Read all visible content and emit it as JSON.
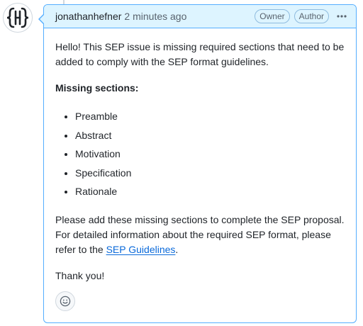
{
  "comment": {
    "author": "jonathanhefner",
    "timestamp": "2 minutes ago",
    "badges": [
      "Owner",
      "Author"
    ],
    "icons": {
      "avatar": "hefner-logo-avatar",
      "menu": "kebab-horizontal-icon",
      "reaction": "smiley-icon"
    },
    "colors": {
      "header_bg": "#ddf4ff",
      "border": "#54aeff",
      "link": "#0969da"
    },
    "body": {
      "intro": "Hello! This SEP issue is missing required sections that need to be added to comply with the SEP format guidelines.",
      "missing_heading": "Missing sections:",
      "missing_sections": [
        "Preamble",
        "Abstract",
        "Motivation",
        "Specification",
        "Rationale"
      ],
      "closing_before_link": "Please add these missing sections to complete the SEP proposal. For detailed information about the required SEP format, please refer to the ",
      "link_text": "SEP Guidelines",
      "closing_after_link": ".",
      "thanks": "Thank you!"
    }
  }
}
